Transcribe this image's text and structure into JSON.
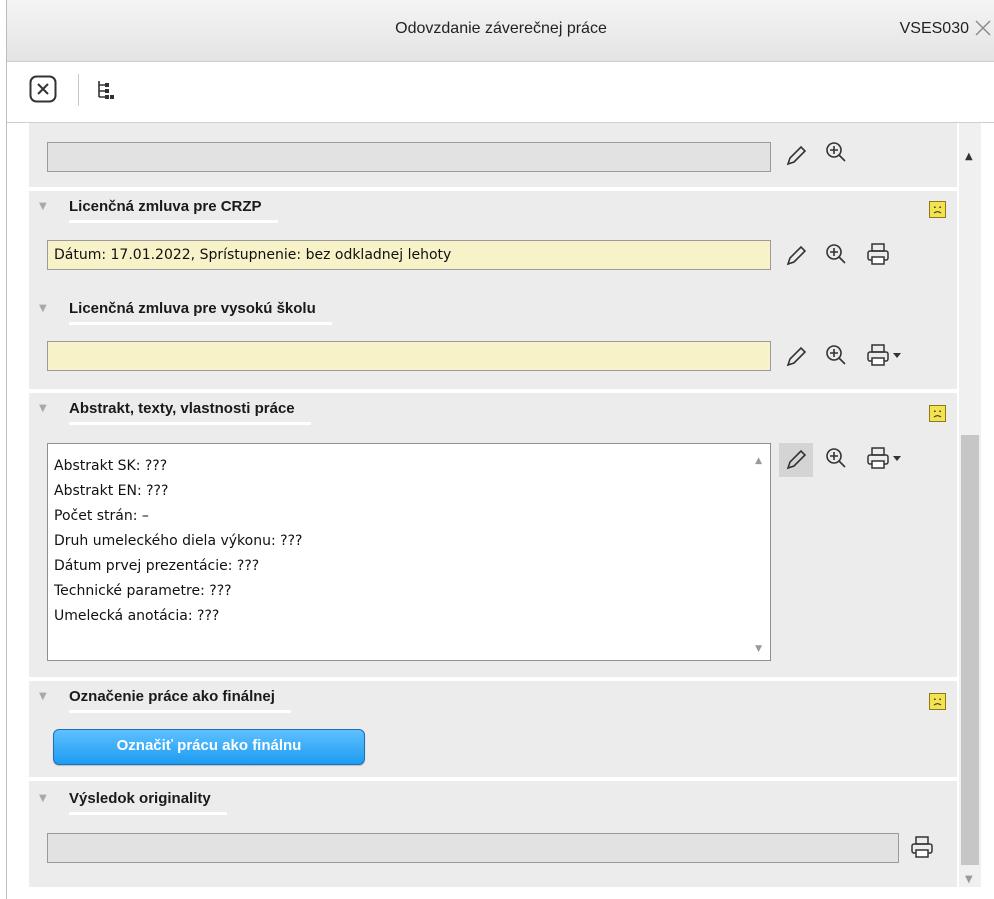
{
  "window": {
    "title": "Odovzdanie záverečnej práce",
    "code": "VSES030"
  },
  "toolbar": {
    "close_icon": "close-box-icon",
    "tree_icon": "tree-structure-icon"
  },
  "sections": {
    "top_field": {
      "value": ""
    },
    "crzp": {
      "label": "Licenčná zmluva pre CRZP",
      "value": "Dátum: 17.01.2022, Sprístupnenie: bez odkladnej lehoty",
      "status_icon": "sad-face-icon"
    },
    "university": {
      "label": "Licenčná zmluva pre vysokú školu",
      "value": ""
    },
    "abstract": {
      "label": "Abstrakt, texty, vlastnosti práce",
      "status_icon": "sad-face-icon",
      "lines": [
        "Abstrakt SK: ???",
        "Abstrakt EN: ???",
        "Počet strán: –",
        "Druh umeleckého diela výkonu: ???",
        "Dátum prvej prezentácie: ???",
        "Technické parametre: ???",
        "Umelecká anotácia: ???"
      ]
    },
    "final": {
      "label": "Označenie práce ako finálnej",
      "button": "Označiť prácu ako finálnu",
      "status_icon": "sad-face-icon"
    },
    "originality": {
      "label": "Výsledok originality",
      "value": ""
    }
  },
  "colors": {
    "yellow_field": "#f7f2c8",
    "button_blue": "#1c9cf2",
    "smiley": "#f3e34f"
  }
}
